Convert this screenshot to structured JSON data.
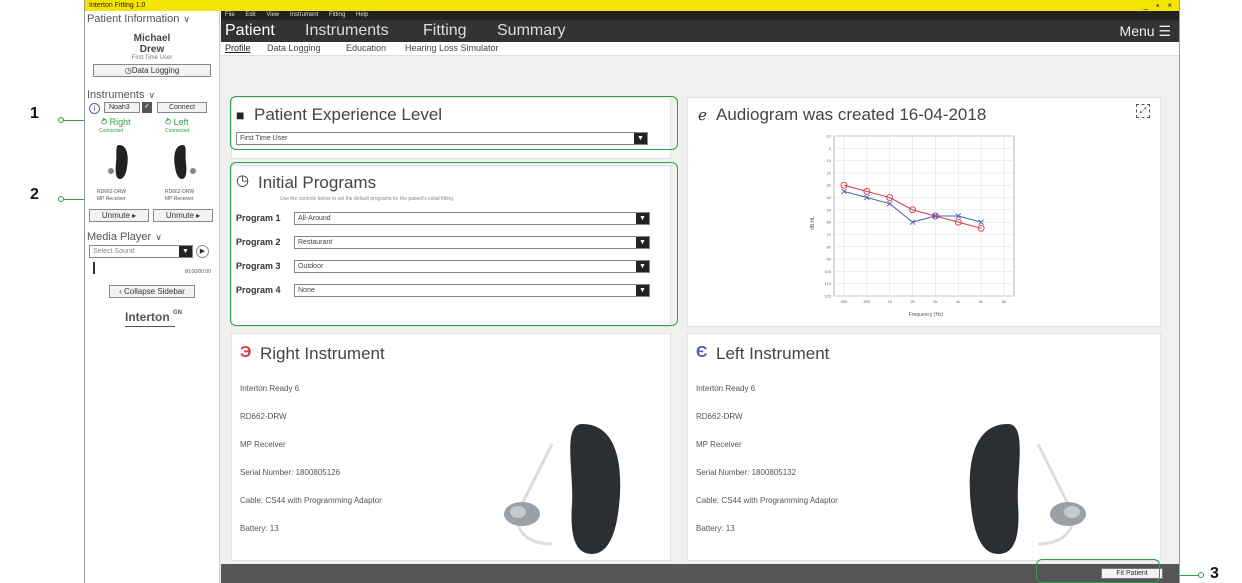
{
  "window": {
    "title": "Interton Fitting 1.0",
    "controls": "_ ▪ ×"
  },
  "menubar": [
    "File",
    "Edit",
    "View",
    "Instrument",
    "Fitting",
    "Help"
  ],
  "tabs": [
    "Patient",
    "Instruments",
    "Fitting",
    "Summary"
  ],
  "menu_label": "Menu ☰",
  "subtabs": [
    "Profile",
    "Data Logging",
    "Education",
    "Hearing Loss Simulator"
  ],
  "sidebar": {
    "patient_header": "Patient Information",
    "first_name": "Michael",
    "last_name": "Drew",
    "patient_sub": "First Time User",
    "data_logging_btn": "Data Logging",
    "instruments_header": "Instruments",
    "info_label": "Noah3",
    "connect_btn": "Connect",
    "right_label": "Right",
    "right_status": "Connected",
    "left_label": "Left",
    "left_status": "Connected",
    "right_model": "RD662-DRW",
    "right_receiver": "MP Receiver",
    "left_model": "RD662-DRW",
    "left_receiver": "MP Receiver",
    "unmute_right": "Unmute ▸",
    "unmute_left": "Unmute ▸",
    "media_header": "Media Player",
    "select_sound": "Select Sound",
    "media_time": "00:00/00:00",
    "collapse_btn": "Collapse Sidebar",
    "logo": "Interton",
    "logo_badge": "GN"
  },
  "experience": {
    "title": "Patient Experience Level",
    "value": "First Time User"
  },
  "programs": {
    "title": "Initial Programs",
    "hint": "Use the controls below to set the default programs for the patient's initial fitting",
    "items": [
      {
        "label": "Program 1",
        "value": "All-Around"
      },
      {
        "label": "Program 2",
        "value": "Restaurant"
      },
      {
        "label": "Program 3",
        "value": "Outdoor"
      },
      {
        "label": "Program 4",
        "value": "None"
      }
    ]
  },
  "audiogram": {
    "title": "Audiogram was created 16-04-2018",
    "ylabel": "dB HL",
    "xlabel": "Frequency (Hz)"
  },
  "chart_data": {
    "type": "line",
    "x": [
      250,
      500,
      1000,
      2000,
      3000,
      4000,
      6000,
      8000
    ],
    "series": [
      {
        "name": "Right",
        "values": [
          30,
          35,
          40,
          50,
          55,
          60,
          65,
          null
        ],
        "color": "#d33b4a"
      },
      {
        "name": "Left",
        "values": [
          35,
          40,
          45,
          60,
          55,
          55,
          60,
          null
        ],
        "color": "#4a5fb5"
      }
    ],
    "xlabel": "Frequency (Hz)",
    "ylabel": "dB HL"
  },
  "right_instrument": {
    "title": "Right Instrument",
    "lines": [
      "Interton Ready 6",
      "RD662-DRW",
      "MP Receiver",
      "Serial Number: 1800805126",
      "Cable: CS44 with Programming Adaptor",
      "Battery: 13"
    ]
  },
  "left_instrument": {
    "title": "Left Instrument",
    "lines": [
      "Interton Ready 6",
      "RD662-DRW",
      "MP Receiver",
      "Serial Number: 1800805132",
      "Cable: CS44 with Programming Adaptor",
      "Battery: 13"
    ]
  },
  "fit_button": "Fit Patient",
  "callouts": [
    "1",
    "2",
    "3"
  ],
  "colors": {
    "accent": "#2f9e45",
    "right": "#d33b4a",
    "left": "#4a5fb5",
    "titlebar": "#f5e400"
  }
}
